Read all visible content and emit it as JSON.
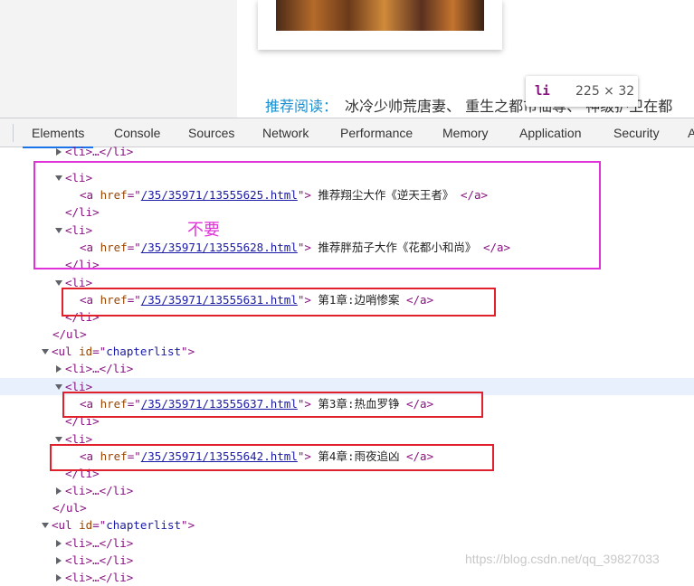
{
  "webpage": {
    "recommend_label": "推荐阅读：",
    "recommend_items": "冰冷少帅荒唐妻、 重生之都市仙尊、 神级护卫在都",
    "tooltip_tag": "li",
    "tooltip_size": "225 × 32"
  },
  "devtools": {
    "tabs": [
      "Elements",
      "Console",
      "Sources",
      "Network",
      "Performance",
      "Memory",
      "Application",
      "Security",
      "A"
    ],
    "active_tab": "Elements"
  },
  "tree": {
    "li_collapsed": "<li>…</li>",
    "li_open": "<li>",
    "li_close": "</li>",
    "ul_close": "</ul>",
    "ul_open_tag": "ul",
    "id_attr": "id",
    "chapterlist": "chapterlist",
    "links": [
      {
        "href": "/35/35971/13555625.html",
        "text": "推荐翔尘大作《逆天王者》"
      },
      {
        "href": "/35/35971/13555628.html",
        "text": "推荐胖茄子大作《花都小和尚》"
      },
      {
        "href": "/35/35971/13555631.html",
        "text": "第1章:边哨惨案"
      },
      {
        "href": "/35/35971/13555637.html",
        "text": "第3章:热血罗铮"
      },
      {
        "href": "/35/35971/13555642.html",
        "text": "第4章:雨夜追凶"
      }
    ]
  },
  "annotations": {
    "note": "不要",
    "watermark": "https://blog.csdn.net/qq_39827033"
  },
  "colors": {
    "magenta_box": "#e032d9",
    "red_box": "#e0202a",
    "tag": "#881280",
    "attr_name": "#994500",
    "attr_value": "#1a1aa6",
    "active_tab_underline": "#1a73e8"
  }
}
